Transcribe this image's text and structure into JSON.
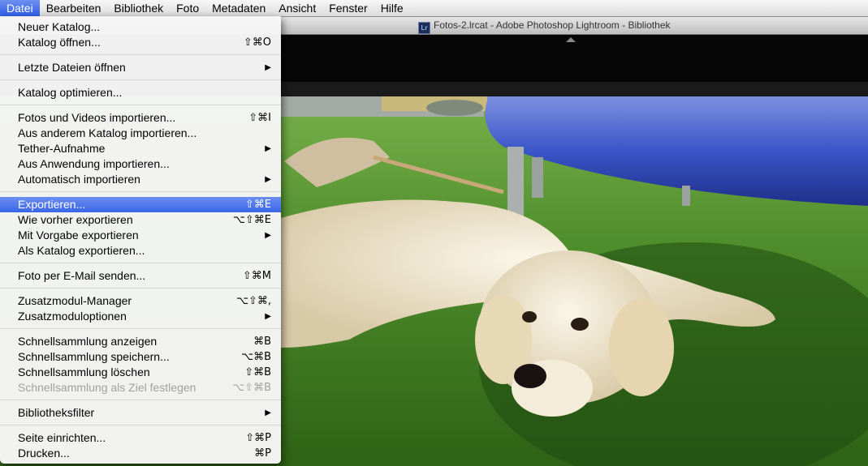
{
  "menubar": {
    "items": [
      "Datei",
      "Bearbeiten",
      "Bibliothek",
      "Foto",
      "Metadaten",
      "Ansicht",
      "Fenster",
      "Hilfe"
    ],
    "active": "Datei"
  },
  "window": {
    "title": "Fotos-2.lrcat - Adobe Photoshop Lightroom - Bibliothek",
    "app_badge": "Lr"
  },
  "file_menu": {
    "items": [
      {
        "label": "Neuer Katalog...",
        "shortcut": "",
        "submenu": false,
        "disabled": false,
        "highlighted": false
      },
      {
        "label": "Katalog öffnen...",
        "shortcut": "⇧⌘O",
        "submenu": false,
        "disabled": false,
        "highlighted": false
      },
      {
        "label": "Letzte Dateien öffnen",
        "shortcut": "",
        "submenu": true,
        "disabled": false,
        "highlighted": false
      },
      {
        "label": "Katalog optimieren...",
        "shortcut": "",
        "submenu": false,
        "disabled": false,
        "highlighted": false
      },
      {
        "label": "Fotos und Videos importieren...",
        "shortcut": "⇧⌘I",
        "submenu": false,
        "disabled": false,
        "highlighted": false
      },
      {
        "label": "Aus anderem Katalog importieren...",
        "shortcut": "",
        "submenu": false,
        "disabled": false,
        "highlighted": false
      },
      {
        "label": "Tether-Aufnahme",
        "shortcut": "",
        "submenu": true,
        "disabled": false,
        "highlighted": false
      },
      {
        "label": "Aus Anwendung importieren...",
        "shortcut": "",
        "submenu": false,
        "disabled": false,
        "highlighted": false
      },
      {
        "label": "Automatisch importieren",
        "shortcut": "",
        "submenu": true,
        "disabled": false,
        "highlighted": false
      },
      {
        "label": "Exportieren...",
        "shortcut": "⇧⌘E",
        "submenu": false,
        "disabled": false,
        "highlighted": true
      },
      {
        "label": "Wie vorher exportieren",
        "shortcut": "⌥⇧⌘E",
        "submenu": false,
        "disabled": false,
        "highlighted": false
      },
      {
        "label": "Mit Vorgabe exportieren",
        "shortcut": "",
        "submenu": true,
        "disabled": false,
        "highlighted": false
      },
      {
        "label": "Als Katalog exportieren...",
        "shortcut": "",
        "submenu": false,
        "disabled": false,
        "highlighted": false
      },
      {
        "label": "Foto per E-Mail senden...",
        "shortcut": "⇧⌘M",
        "submenu": false,
        "disabled": false,
        "highlighted": false
      },
      {
        "label": "Zusatzmodul-Manager",
        "shortcut": "⌥⇧⌘,",
        "submenu": false,
        "disabled": false,
        "highlighted": false
      },
      {
        "label": "Zusatzmoduloptionen",
        "shortcut": "",
        "submenu": true,
        "disabled": false,
        "highlighted": false
      },
      {
        "label": "Schnellsammlung anzeigen",
        "shortcut": "⌘B",
        "submenu": false,
        "disabled": false,
        "highlighted": false
      },
      {
        "label": "Schnellsammlung speichern...",
        "shortcut": "⌥⌘B",
        "submenu": false,
        "disabled": false,
        "highlighted": false
      },
      {
        "label": "Schnellsammlung löschen",
        "shortcut": "⇧⌘B",
        "submenu": false,
        "disabled": false,
        "highlighted": false
      },
      {
        "label": "Schnellsammlung als Ziel festlegen",
        "shortcut": "⌥⇧⌘B",
        "submenu": false,
        "disabled": true,
        "highlighted": false
      },
      {
        "label": "Bibliotheksfilter",
        "shortcut": "",
        "submenu": true,
        "disabled": false,
        "highlighted": false
      },
      {
        "label": "Seite einrichten...",
        "shortcut": "⇧⌘P",
        "submenu": false,
        "disabled": false,
        "highlighted": false
      },
      {
        "label": "Drucken...",
        "shortcut": "⌘P",
        "submenu": false,
        "disabled": false,
        "highlighted": false
      }
    ],
    "submenu_arrow": "▶"
  },
  "colors": {
    "highlight": "#3a66e8",
    "disabled_text": "#a0a0a0"
  }
}
